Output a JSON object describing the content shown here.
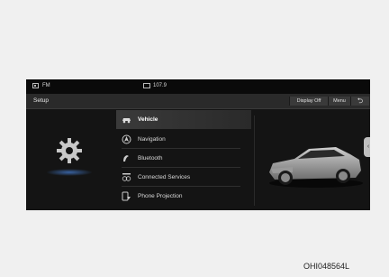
{
  "status_bar": {
    "source": "FM",
    "frequency": "107.9"
  },
  "title_bar": {
    "title": "Setup",
    "display_off": "Display Off",
    "menu": "Menu",
    "back": "⮌"
  },
  "menu": {
    "items": [
      {
        "label": "Vehicle",
        "icon": "vehicle-icon",
        "selected": true
      },
      {
        "label": "Navigation",
        "icon": "navigation-icon"
      },
      {
        "label": "Bluetooth",
        "icon": "bluetooth-icon"
      },
      {
        "label": "Connected Services",
        "icon": "connected-services-icon"
      },
      {
        "label": "Phone Projection",
        "icon": "phone-projection-icon"
      }
    ]
  },
  "side_handle": "‹",
  "caption": "OHI048564L"
}
